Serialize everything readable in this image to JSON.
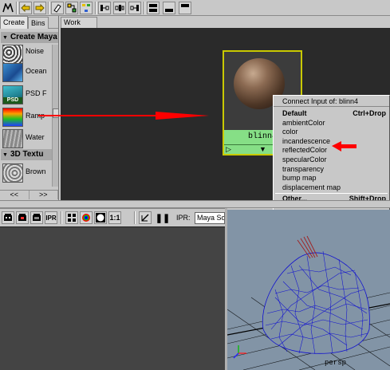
{
  "left_panel": {
    "tabs": [
      "Create",
      "Bins"
    ],
    "section_create": "Create Maya",
    "items": [
      {
        "label": "Noise"
      },
      {
        "label": "Ocean"
      },
      {
        "label": "PSD F"
      },
      {
        "label": "Ramp"
      },
      {
        "label": "Water"
      }
    ],
    "section_3d": "3D Textu",
    "items_3d": [
      {
        "label": "Brown"
      }
    ],
    "nav_prev": "<<",
    "nav_next": ">>"
  },
  "work_area": {
    "tab_label": "Work Area",
    "node_name": "blinn4"
  },
  "context_menu": {
    "title": "Connect Input of: blinn4",
    "default_label": "Default",
    "default_shortcut": "Ctrl+Drop",
    "items": [
      "ambientColor",
      "color",
      "incandescence",
      "reflectedColor",
      "specularColor",
      "transparency",
      "bump map",
      "displacement map"
    ],
    "other_label": "Other...",
    "other_shortcut": "Shift+Drop"
  },
  "render_toolbar": {
    "ratio_label": "1:1",
    "ipr_label": "IPR:",
    "renderer_value": "Maya So",
    "ipr_badge": "IPR"
  },
  "viewport": {
    "camera_label": "persp"
  },
  "colors": {
    "work_area_bg": "#2a2a2a",
    "node_highlight": "#c9c900",
    "node_green": "#86df86",
    "arrow_red": "#ff0000",
    "wireframe_blue": "#1010d0"
  },
  "icons": [
    "arrow-left-icon",
    "arrow-right-icon",
    "eraser-icon",
    "hypershade-layout-icon",
    "graph-icons",
    "layout-icons"
  ]
}
